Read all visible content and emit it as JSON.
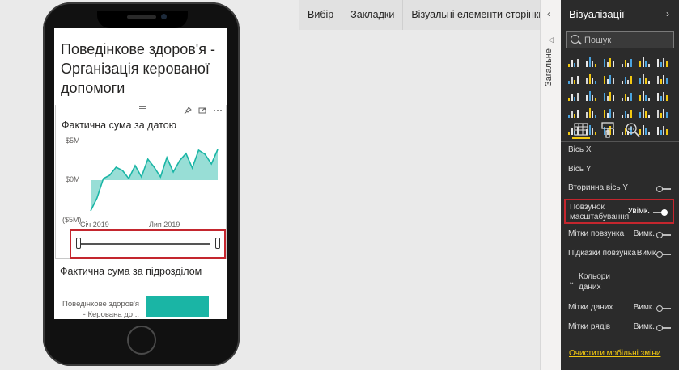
{
  "top_tabs": [
    {
      "label": "Вибір"
    },
    {
      "label": "Закладки"
    },
    {
      "label": "Візуальні елементи сторінки"
    }
  ],
  "report": {
    "title": "Поведінкове здоров'я - Організація керованої допомоги",
    "visual1": {
      "title": "Фактична сума за датою",
      "chart_data": {
        "type": "area",
        "title": "Фактична сума за датою",
        "y_ticks": [
          "$5M",
          "$0M",
          "($5M)"
        ],
        "ylim": [
          -5,
          5
        ],
        "y_unit": "M",
        "x_ticks": [
          "Січ 2019",
          "Лип 2019"
        ],
        "series": [
          {
            "values": [
              -3.8,
              -2.2,
              0.2,
              0.6,
              1.6,
              1.2,
              0.2,
              1.8,
              0.4,
              2.6,
              1.6,
              0.4,
              2.8,
              1.0,
              2.4,
              3.3,
              1.5,
              3.7,
              3.2,
              2.0,
              3.8
            ]
          }
        ],
        "grid": false,
        "color": "#1ab5a5"
      }
    },
    "visual2": {
      "title": "Фактична сума за підрозділом",
      "chart_data": {
        "type": "bar",
        "categories": [
          "Поведінкове здоров'я - Керована до..."
        ],
        "values": [
          1.0
        ],
        "color": "#1ab5a5"
      },
      "bar_label_line1": "Поведінкове здоров'я",
      "bar_label_line2": "- Керована до..."
    }
  },
  "side_strip": {
    "label": "Загальне"
  },
  "viz_pane": {
    "title": "Візуалізації",
    "search_placeholder": "Пошук",
    "icons": [
      "stacked-bar-icon",
      "stacked-column-icon",
      "clustered-bar-icon",
      "clustered-column-icon",
      "100-bar-icon",
      "100-column-icon",
      "line-chart-icon",
      "area-chart-icon",
      "stacked-area-icon",
      "line-column-icon",
      "line-clustered-column-icon",
      "ribbon-chart-icon",
      "waterfall-icon",
      "scatter-icon",
      "pie-icon",
      "donut-icon",
      "treemap-icon",
      "map-icon",
      "filled-map-icon",
      "funnel-icon",
      "gauge-icon",
      "card-icon",
      "multirow-card-icon",
      "kpi-icon",
      "slicer-icon",
      "table-icon",
      "matrix-icon",
      "r-script-icon",
      "globe-icon",
      "more-icon"
    ],
    "format_tabs": [
      "fields-tab-icon",
      "format-paint-icon",
      "analytics-icon"
    ],
    "settings": {
      "x_axis": "Вісь X",
      "y_axis": "Вісь Y",
      "secondary_y": "Вторинна вісь Y",
      "zoom_slider_line1": "Повзунок",
      "zoom_slider_line2": "масштабування",
      "zoom_slider_state": "Увімк.",
      "slider_labels": "Мітки повзунка",
      "slider_labels_state": "Вимк.",
      "slider_tooltips": "Підказки повзунка",
      "slider_tooltips_state": "Вимк.",
      "data_colors_line1": "Кольори",
      "data_colors_line2": "даних",
      "data_labels": "Мітки даних",
      "data_labels_state": "Вимк.",
      "series_labels": "Мітки рядів",
      "series_labels_state": "Вимк."
    },
    "reset_link": "Очистити мобільні зміни"
  }
}
